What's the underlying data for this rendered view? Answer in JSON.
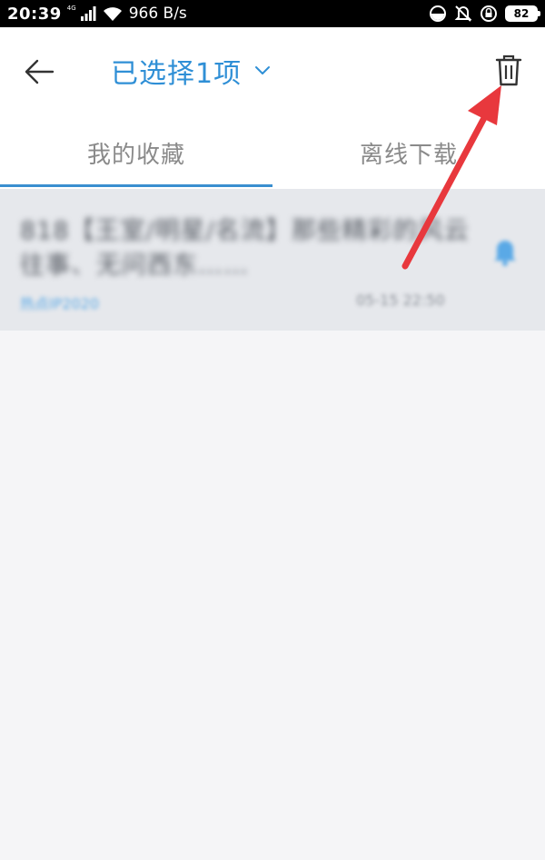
{
  "status_bar": {
    "time": "20:39",
    "network": "4G",
    "speed": "966 B/s",
    "battery": "82"
  },
  "header": {
    "title": "已选择1项",
    "back_icon": "arrow-left-icon",
    "dropdown_icon": "chevron-down-icon",
    "delete_icon": "trash-icon"
  },
  "tabs": [
    {
      "label": "我的收藏",
      "active": true
    },
    {
      "label": "离线下载",
      "active": false
    }
  ],
  "list": {
    "items": [
      {
        "title": "818【王室/明星/名流】那些精彩的风云往事、无问西东……",
        "source": "热点IP2020",
        "date": "05-15 22:50",
        "icon": "bell-icon"
      }
    ]
  },
  "colors": {
    "accent": "#2f8fd6",
    "tab_indicator": "#3a8fd0",
    "annotation": "#e8383d",
    "selected_row": "#e6e8ec"
  }
}
